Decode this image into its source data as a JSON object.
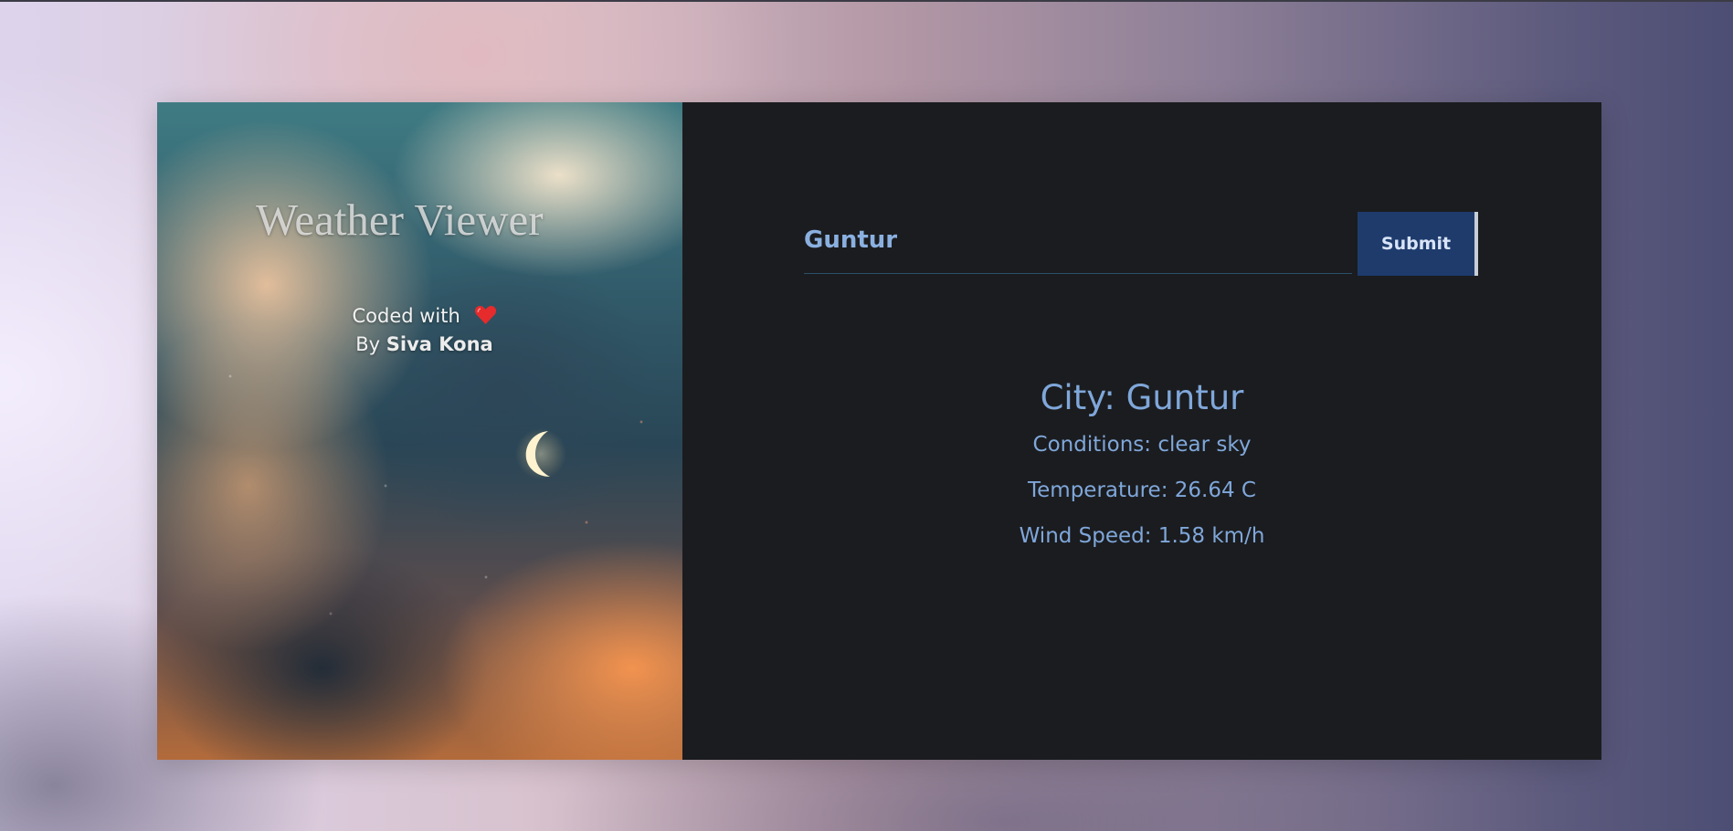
{
  "hero": {
    "title": "Weather Viewer",
    "credit_line": "Coded with",
    "by_prefix": "By",
    "author": "Siva Kona",
    "heart_icon": "heart-icon",
    "moon_icon": "crescent-moon"
  },
  "search": {
    "value": "Guntur",
    "submit_label": "Submit"
  },
  "weather": {
    "city": "City: Guntur",
    "conditions": "Conditions: clear sky",
    "temperature": "Temperature: 26.64 C",
    "wind_speed": "Wind Speed: 1.58 km/h"
  },
  "colors": {
    "panel_bg": "#1b1c1f",
    "accent_text": "#7fa7da",
    "button_bg": "#1e3b6c"
  }
}
